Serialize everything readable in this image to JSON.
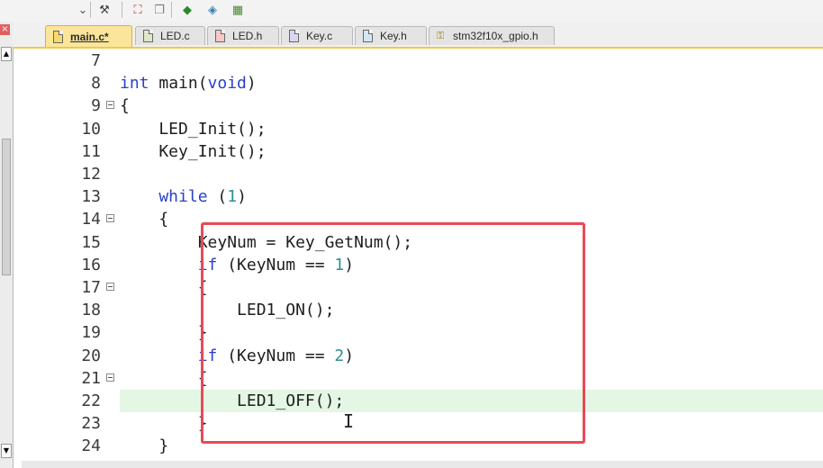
{
  "toolbar": {
    "buttons": [
      {
        "name": "dropdown-arrow-icon",
        "glyph": "⌄"
      },
      {
        "name": "wand-icon",
        "glyph": "⚒"
      },
      {
        "name": "pack-installer-icon",
        "glyph": "⛶"
      },
      {
        "name": "window-stack-icon",
        "glyph": "❐"
      },
      {
        "name": "target-options-icon",
        "glyph": "◆"
      },
      {
        "name": "select-device-icon",
        "glyph": "◈"
      },
      {
        "name": "manage-components-icon",
        "glyph": "▦"
      }
    ]
  },
  "left_panel": {
    "close_glyph": "×",
    "up_glyph": "▲",
    "down_glyph": "▼"
  },
  "tabs": [
    {
      "label": "main.c*",
      "active": true,
      "icon": "file-icon"
    },
    {
      "label": "LED.c",
      "active": false,
      "icon": "file-icon"
    },
    {
      "label": "LED.h",
      "active": false,
      "icon": "file-icon"
    },
    {
      "label": "Key.c",
      "active": false,
      "icon": "file-icon"
    },
    {
      "label": "Key.h",
      "active": false,
      "icon": "file-icon"
    },
    {
      "label": "stm32f10x_gpio.h",
      "active": false,
      "icon": "key-icon"
    }
  ],
  "editor": {
    "lines": [
      {
        "num": "7",
        "fold": false,
        "tokens": []
      },
      {
        "num": "8",
        "fold": false,
        "tokens": [
          [
            "kw",
            "int"
          ],
          [
            "t",
            " main("
          ],
          [
            "kw",
            "void"
          ],
          [
            "t",
            ")"
          ]
        ]
      },
      {
        "num": "9",
        "fold": true,
        "tokens": [
          [
            "t",
            "{"
          ]
        ]
      },
      {
        "num": "10",
        "fold": false,
        "tokens": [
          [
            "t",
            "    LED_Init();"
          ]
        ]
      },
      {
        "num": "11",
        "fold": false,
        "tokens": [
          [
            "t",
            "    Key_Init();"
          ]
        ]
      },
      {
        "num": "12",
        "fold": false,
        "tokens": []
      },
      {
        "num": "13",
        "fold": false,
        "tokens": [
          [
            "kw",
            "    while"
          ],
          [
            "t",
            " ("
          ],
          [
            "num",
            "1"
          ],
          [
            "t",
            ")"
          ]
        ]
      },
      {
        "num": "14",
        "fold": true,
        "tokens": [
          [
            "t",
            "    {"
          ]
        ]
      },
      {
        "num": "15",
        "fold": false,
        "tokens": [
          [
            "t",
            "        KeyNum = Key_GetNum();"
          ]
        ]
      },
      {
        "num": "16",
        "fold": false,
        "tokens": [
          [
            "kw",
            "        if"
          ],
          [
            "t",
            " (KeyNum == "
          ],
          [
            "num",
            "1"
          ],
          [
            "t",
            ")"
          ]
        ]
      },
      {
        "num": "17",
        "fold": true,
        "tokens": [
          [
            "t",
            "        {"
          ]
        ]
      },
      {
        "num": "18",
        "fold": false,
        "tokens": [
          [
            "t",
            "            LED1_ON();"
          ]
        ]
      },
      {
        "num": "19",
        "fold": false,
        "tokens": [
          [
            "t",
            "        }"
          ]
        ]
      },
      {
        "num": "20",
        "fold": false,
        "tokens": [
          [
            "kw",
            "        if"
          ],
          [
            "t",
            " (KeyNum == "
          ],
          [
            "num",
            "2"
          ],
          [
            "t",
            ")"
          ]
        ]
      },
      {
        "num": "21",
        "fold": true,
        "tokens": [
          [
            "t",
            "        {"
          ]
        ]
      },
      {
        "num": "22",
        "fold": false,
        "current": true,
        "tokens": [
          [
            "t",
            "            LED1_OFF();"
          ]
        ]
      },
      {
        "num": "23",
        "fold": false,
        "tokens": [
          [
            "t",
            "        }"
          ]
        ]
      },
      {
        "num": "24",
        "fold": false,
        "tokens": [
          [
            "t",
            "    }"
          ]
        ]
      }
    ],
    "cursor_glyph": "I"
  },
  "colors": {
    "keyword": "#2b40c8",
    "number": "#2f8f8f",
    "highlight_box": "#e84a55",
    "current_line": "#e4f6e4",
    "active_tab": "#fbe59a"
  }
}
